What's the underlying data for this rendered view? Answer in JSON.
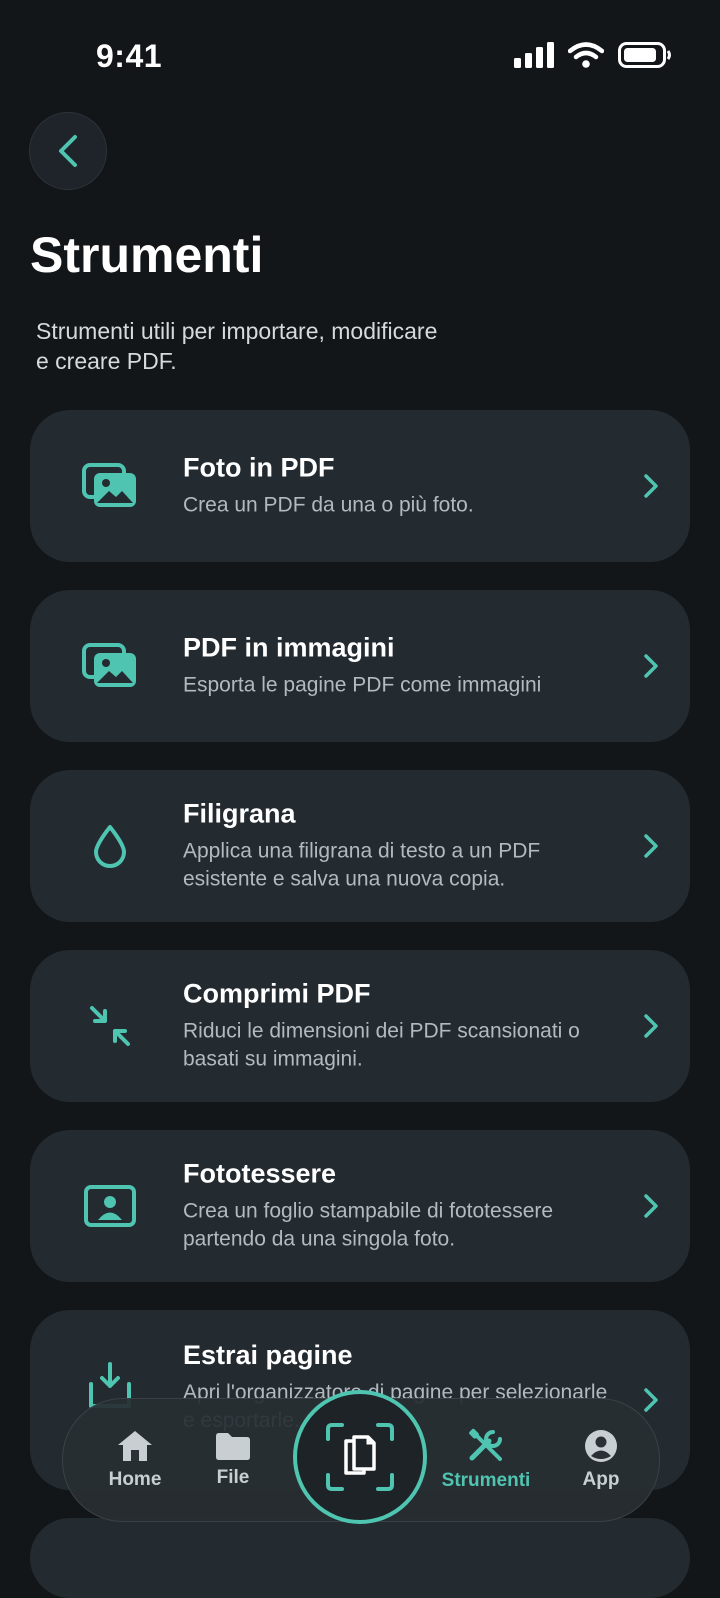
{
  "status": {
    "time": "9:41"
  },
  "header": {
    "back_icon": "chevron-left-icon",
    "title": "Strumenti",
    "subtitle": "Strumenti utili per importare, modificare e creare PDF."
  },
  "tools": [
    {
      "icon": "photos-icon",
      "title": "Foto in PDF",
      "description": "Crea un PDF da una o più foto."
    },
    {
      "icon": "photos-icon",
      "title": "PDF in immagini",
      "description": "Esporta le pagine PDF come immagini"
    },
    {
      "icon": "droplet-icon",
      "title": "Filigrana",
      "description": "Applica una filigrana di testo a un PDF esistente e salva una nuova copia."
    },
    {
      "icon": "compress-arrows-icon",
      "title": "Comprimi PDF",
      "description": "Riduci le dimensioni dei PDF scansionati o basati su immagini."
    },
    {
      "icon": "id-photo-icon",
      "title": "Fototessere",
      "description": "Crea un foglio stampabile di fototessere partendo da una singola foto."
    },
    {
      "icon": "extract-pages-icon",
      "title": "Estrai pagine",
      "description": "Apri l'organizzatore di pagine per selezionarle e esportarle."
    }
  ],
  "tabbar": {
    "tabs": [
      {
        "label": "Home",
        "icon": "home-icon"
      },
      {
        "label": "File",
        "icon": "folder-icon"
      },
      {
        "label": "Strumenti",
        "icon": "tools-icon",
        "active": true
      },
      {
        "label": "App",
        "icon": "person-icon"
      }
    ],
    "scan_icon": "scan-document-icon"
  },
  "colors": {
    "accent": "#4fc4b0",
    "background": "#121619",
    "card": "#232a30"
  }
}
